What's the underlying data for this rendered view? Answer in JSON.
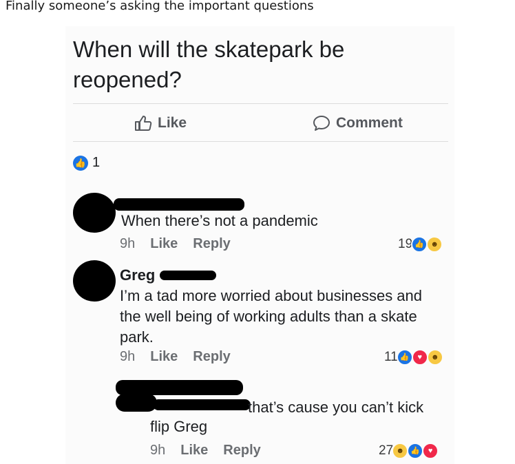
{
  "caption": "Finally someone’s asking the important questions",
  "post": {
    "question": "When will the skatepark be reopened?",
    "like_label": "Like",
    "comment_label": "Comment",
    "reaction_count": "1",
    "icons": {
      "like": "thumbs-up-icon",
      "comment": "speech-bubble-icon"
    },
    "colors": {
      "like_blue": "#1b74e4",
      "love_red": "#f0284a",
      "haha_yellow": "#f7c843"
    }
  },
  "comments": [
    {
      "text": "When there’s not a pandemic",
      "time": "9h",
      "like": "Like",
      "reply": "Reply",
      "reactions_count": "19",
      "reactions": [
        "like",
        "haha"
      ]
    },
    {
      "author": "Greg",
      "text": "I’m a tad more worried about businesses and the well being of working adults than a skate park.",
      "time": "9h",
      "like": "Like",
      "reply": "Reply",
      "reactions_count": "11",
      "reactions": [
        "like",
        "love",
        "haha"
      ]
    },
    {
      "text_line1": "that’s cause you can’t kick",
      "text_line2": "flip Greg",
      "time": "9h",
      "like": "Like",
      "reply": "Reply",
      "reactions_count": "27",
      "reactions": [
        "haha",
        "like",
        "love"
      ]
    }
  ]
}
